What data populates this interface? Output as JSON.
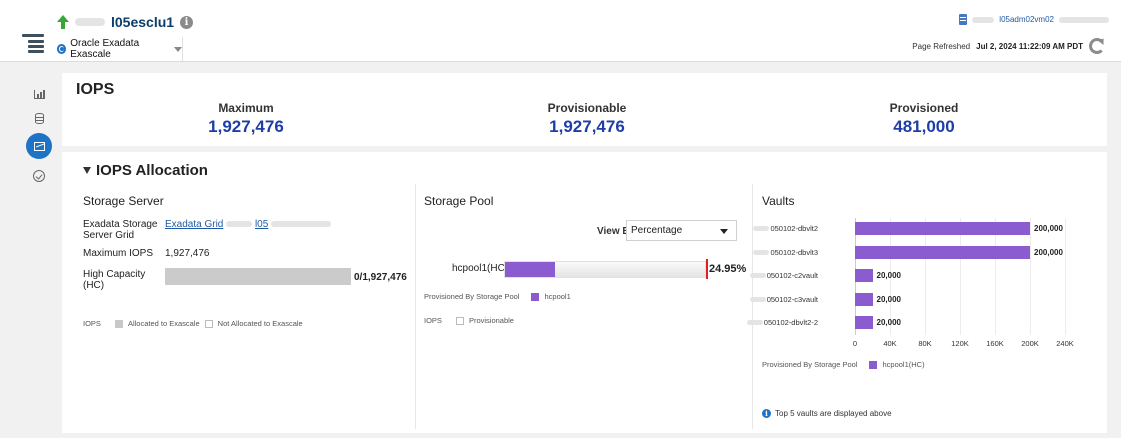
{
  "header": {
    "cluster_name": "l05esclu1",
    "target_type": "Oracle Exadata Exascale",
    "host_name": "l05adm02vm02",
    "refresh_label": "Page Refreshed",
    "refresh_time": "Jul 2, 2024 11:22:09 AM PDT",
    "status": "up"
  },
  "rail": {
    "icons": [
      "bar-chart-icon",
      "database-icon",
      "performance-icon",
      "compliance-check-icon"
    ],
    "active": "performance-icon"
  },
  "iops": {
    "title": "IOPS",
    "metrics": [
      {
        "label": "Maximum",
        "value": "1,927,476"
      },
      {
        "label": "Provisionable",
        "value": "1,927,476"
      },
      {
        "label": "Provisioned",
        "value": "481,000"
      }
    ]
  },
  "allocation": {
    "title": "IOPS Allocation",
    "storage_server": {
      "title": "Storage Server",
      "grid_label": "Exadata Storage Server Grid",
      "grid_link_1": "Exadata Grid",
      "grid_link_2": "l05",
      "max_iops_label": "Maximum IOPS",
      "max_iops_value": "1,927,476",
      "hc_label": "High Capacity (HC)",
      "hc_value": "0/1,927,476",
      "hc_fraction": 0,
      "legend_title": "IOPS",
      "legend_allocated": "Allocated to Exascale",
      "legend_not_allocated": "Not Allocated to Exascale"
    },
    "storage_pool": {
      "title": "Storage Pool",
      "view_by_label": "View By",
      "view_by_value": "Percentage",
      "pool_name": "hcpool1(HC)",
      "pool_percent": 24.95,
      "pool_value_text": "24.95%",
      "legend_title": "Provisioned By Storage Pool",
      "legend_item": "hcpool1",
      "iops_legend_title": "IOPS",
      "iops_legend_item": "Provisionable"
    },
    "vaults": {
      "title": "Vaults",
      "legend_title": "Provisioned By Storage Pool",
      "legend_item": "hcpool1(HC)",
      "note": "Top 5 vaults are displayed above"
    }
  },
  "chart_data": {
    "type": "bar",
    "orientation": "horizontal",
    "categories": [
      "l050102-dbvlt2",
      "l050102-dbvlt3",
      "l050102-c2vault",
      "l050102-c3vault",
      "l050102-dbvlt2-2"
    ],
    "values": [
      200000,
      200000,
      20000,
      20000,
      20000
    ],
    "value_labels": [
      "200,000",
      "200,000",
      "20,000",
      "20,000",
      "20,000"
    ],
    "xlim": [
      0,
      240000
    ],
    "ticks": [
      "0",
      "40K",
      "80K",
      "120K",
      "160K",
      "200K",
      "240K"
    ],
    "series": [
      {
        "name": "hcpool1(HC)",
        "color": "#8a5cd0"
      }
    ],
    "grid": true
  },
  "colors": {
    "accent": "#1d74c6",
    "metric_value": "#1f3da6",
    "bar": "#8a5cd0",
    "status_up": "#3aa537",
    "marker": "#e02020"
  }
}
